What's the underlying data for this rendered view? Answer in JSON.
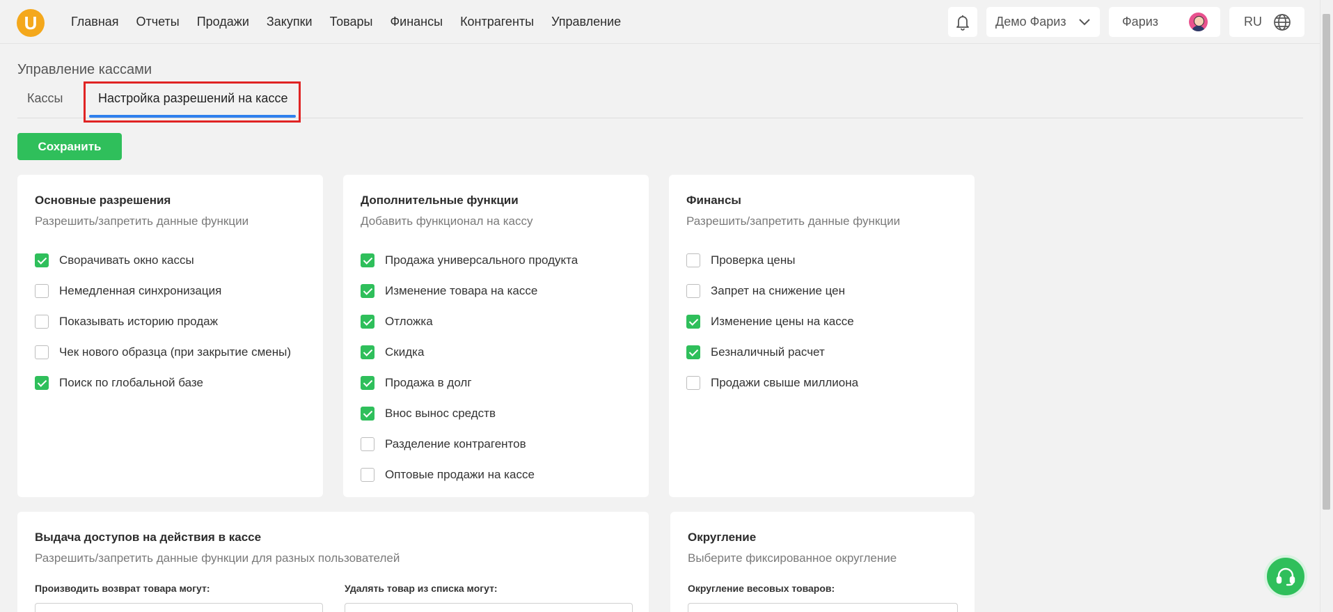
{
  "logo": {
    "letter": "U"
  },
  "nav": {
    "items": [
      "Главная",
      "Отчеты",
      "Продажи",
      "Закупки",
      "Товары",
      "Финансы",
      "Контрагенты",
      "Управление"
    ]
  },
  "header": {
    "company": "Демо Фариз",
    "user": "Фариз",
    "lang": "RU"
  },
  "page": {
    "title": "Управление кассами"
  },
  "tabs": [
    {
      "label": "Кассы"
    },
    {
      "label": "Настройка разрешений на кассе"
    }
  ],
  "toolbar": {
    "save_label": "Сохранить"
  },
  "colors": {
    "accent": "#2fbf5b",
    "tab_active": "#2f80ed",
    "highlight": "#e02424",
    "logo": "#f4a81c"
  },
  "cards": {
    "basic": {
      "title": "Основные разрешения",
      "subtitle": "Разрешить/запретить данные функции",
      "options": [
        {
          "label": "Сворачивать окно кассы",
          "checked": true
        },
        {
          "label": "Немедленная синхронизация",
          "checked": false
        },
        {
          "label": "Показывать историю продаж",
          "checked": false
        },
        {
          "label": "Чек нового образца (при закрытие смены)",
          "checked": false
        },
        {
          "label": "Поиск по глобальной базе",
          "checked": true
        }
      ]
    },
    "extra": {
      "title": "Дополнительные функции",
      "subtitle": "Добавить функционал на кассу",
      "options": [
        {
          "label": "Продажа универсального продукта",
          "checked": true
        },
        {
          "label": "Изменение товара на кассе",
          "checked": true
        },
        {
          "label": "Отложка",
          "checked": true
        },
        {
          "label": "Скидка",
          "checked": true
        },
        {
          "label": "Продажа в долг",
          "checked": true
        },
        {
          "label": "Внос вынос средств",
          "checked": true
        },
        {
          "label": "Разделение контрагентов",
          "checked": false
        },
        {
          "label": "Оптовые продажи на кассе",
          "checked": false
        }
      ]
    },
    "finance": {
      "title": "Финансы",
      "subtitle": "Разрешить/запретить данные функции",
      "options": [
        {
          "label": "Проверка цены",
          "checked": false
        },
        {
          "label": "Запрет на снижение цен",
          "checked": false
        },
        {
          "label": "Изменение цены на кассе",
          "checked": true
        },
        {
          "label": "Безналичный расчет",
          "checked": true
        },
        {
          "label": "Продажи свыше миллиона",
          "checked": false
        }
      ]
    },
    "access": {
      "title": "Выдача доступов на действия в кассе",
      "subtitle": "Разрешить/запретить данные функции для разных пользователей",
      "field1_label": "Производить возврат товара могут:",
      "field2_label": "Удалять товар из списка могут:"
    },
    "rounding": {
      "title": "Округление",
      "subtitle": "Выберите фиксированное округление",
      "field_label": "Округление весовых товаров:"
    }
  }
}
